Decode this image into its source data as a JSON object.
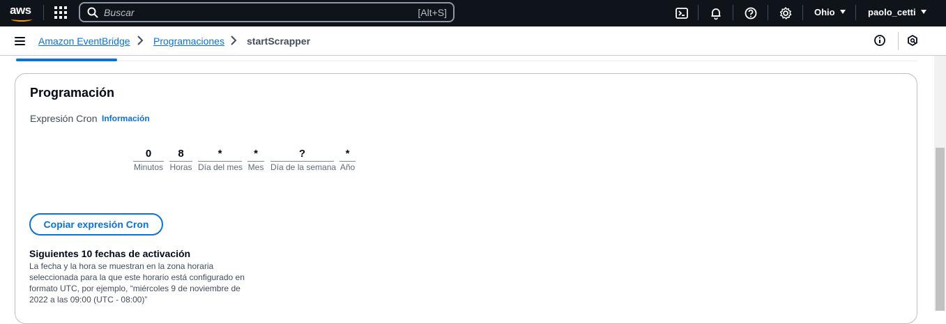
{
  "topnav": {
    "logo_text": "aws",
    "search_placeholder": "Buscar",
    "search_shortcut": "[Alt+S]",
    "region": "Ohio",
    "user": "paolo_cetti",
    "icons": [
      "cloudshell-icon",
      "bell-icon",
      "help-icon",
      "gear-icon"
    ]
  },
  "breadcrumb": {
    "items": [
      "Amazon EventBridge",
      "Programaciones"
    ],
    "current": "startScrapper"
  },
  "panel": {
    "title": "Programación",
    "cron_label": "Expresión Cron",
    "info_link": "Información",
    "fields": [
      {
        "value": "0",
        "label": "Minutos"
      },
      {
        "value": "8",
        "label": "Horas"
      },
      {
        "value": "*",
        "label": "Día del mes"
      },
      {
        "value": "*",
        "label": "Mes"
      },
      {
        "value": "?",
        "label": "Día de la semana"
      },
      {
        "value": "*",
        "label": "Año"
      }
    ],
    "copy_button": "Copiar expresión Cron",
    "next_title": "Siguientes 10 fechas de activación",
    "next_desc": "La fecha y la hora se muestran en la zona horaria seleccionada para la que este horario está configurado en formato UTC, por ejemplo, “miércoles 9 de noviembre de 2022 a las 09:00 (UTC - 08:00)”"
  },
  "colors": {
    "nav_bg": "#0f141a",
    "link": "#0972d3",
    "accent_orange": "#ff9900"
  }
}
